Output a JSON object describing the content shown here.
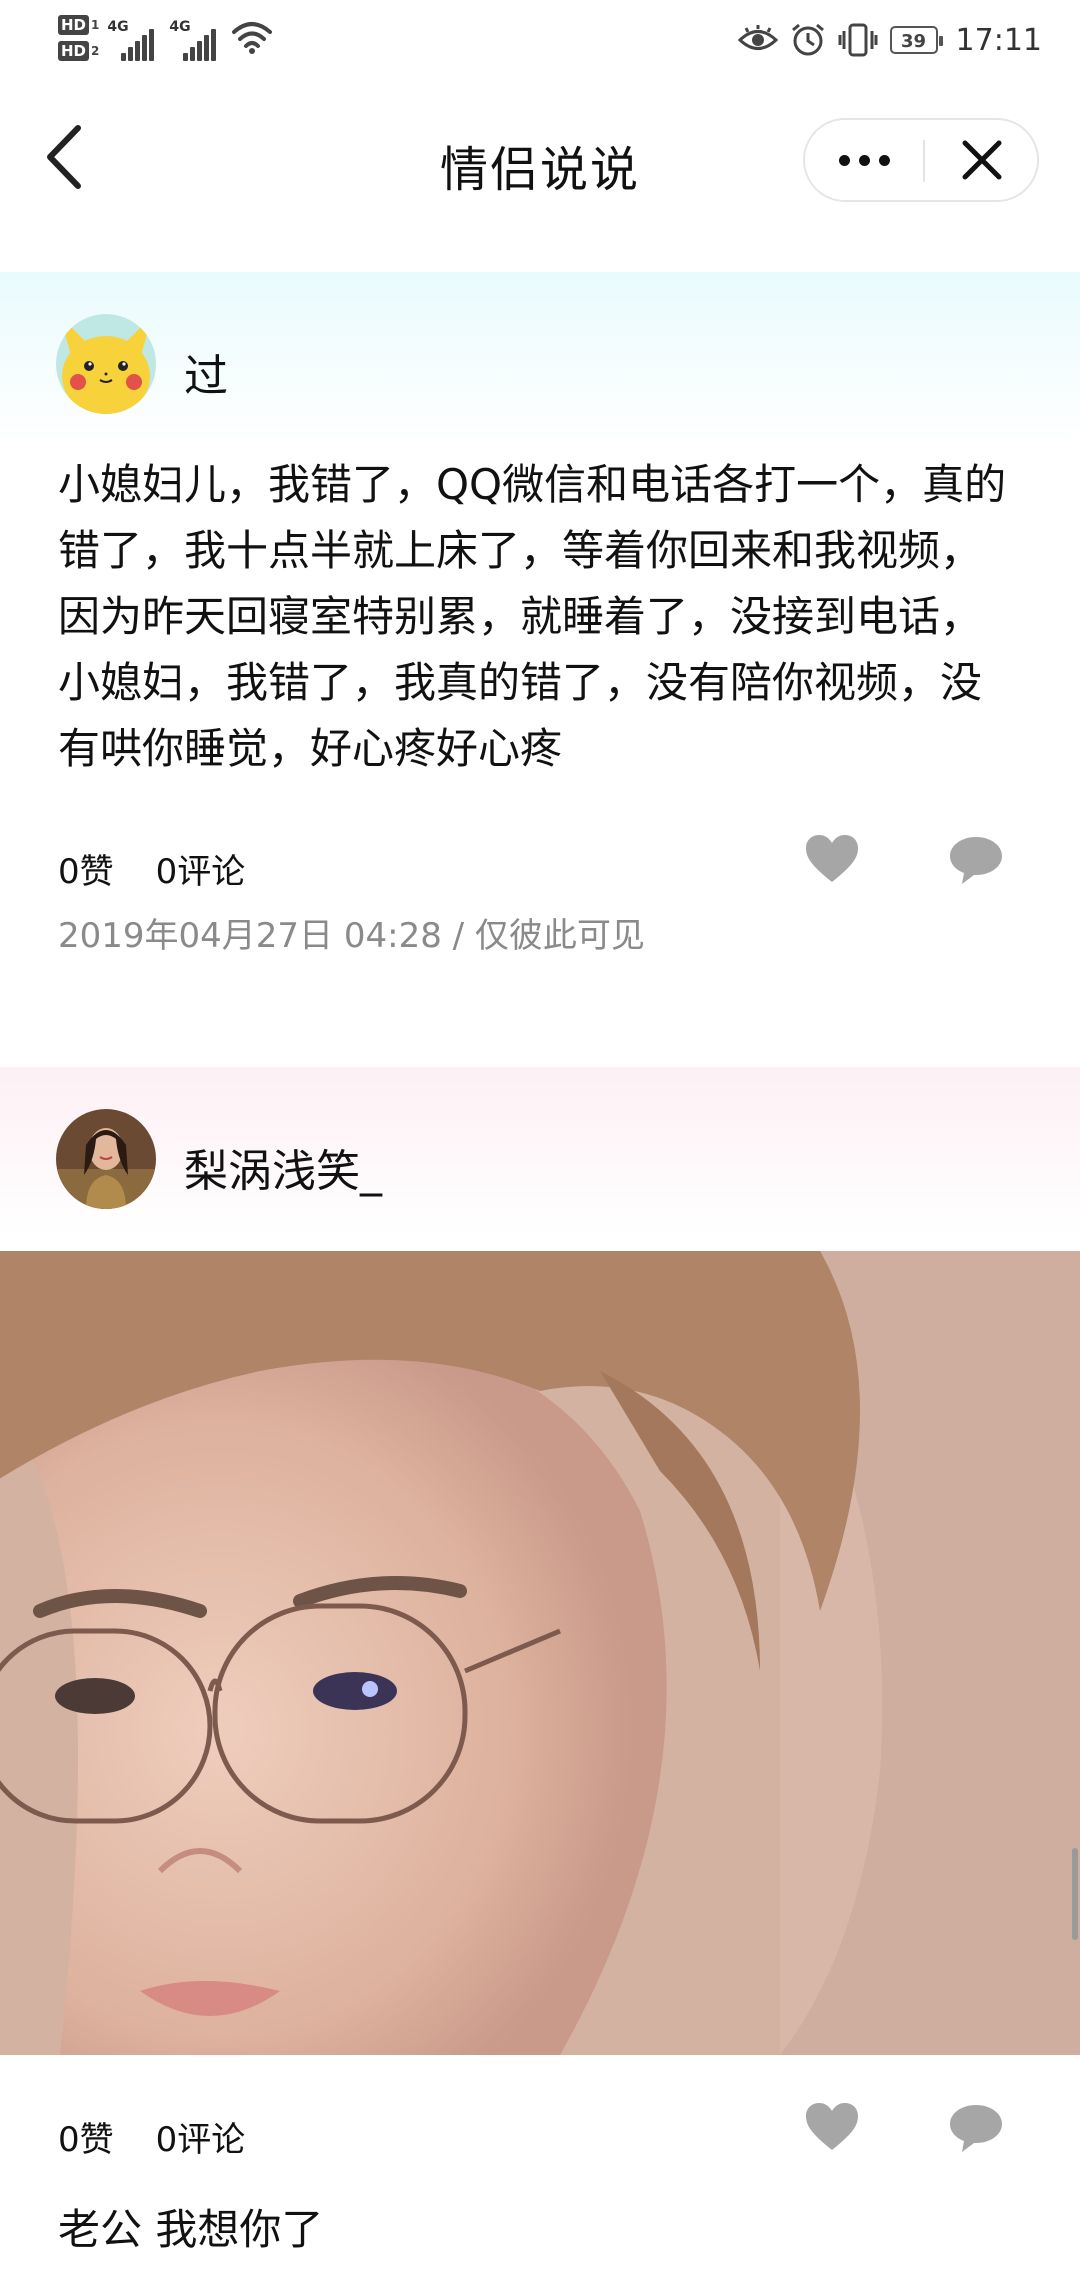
{
  "status_bar": {
    "hd1": "HD",
    "hd1_num": "1",
    "hd2": "HD",
    "hd2_num": "2",
    "net1": "4G",
    "net2": "4G",
    "battery": "39",
    "time": "17:11"
  },
  "nav": {
    "title": "情侣说说"
  },
  "posts": [
    {
      "username": "过",
      "text": "小媳妇儿，我错了，QQ微信和电话各打一个，真的错了，我十点半就上床了，等着你回来和我视频，因为昨天回寝室特别累，就睡着了，没接到电话，小媳妇，我错了，我真的错了，没有陪你视频，没有哄你睡觉，好心疼好心疼",
      "likes": "0赞",
      "comments": "0评论",
      "date": "2019年04月27日 04:28 / 仅彼此可见"
    },
    {
      "username": "梨涡浅笑_",
      "likes": "0赞",
      "comments": "0评论",
      "text": "老公 我想你了"
    }
  ]
}
